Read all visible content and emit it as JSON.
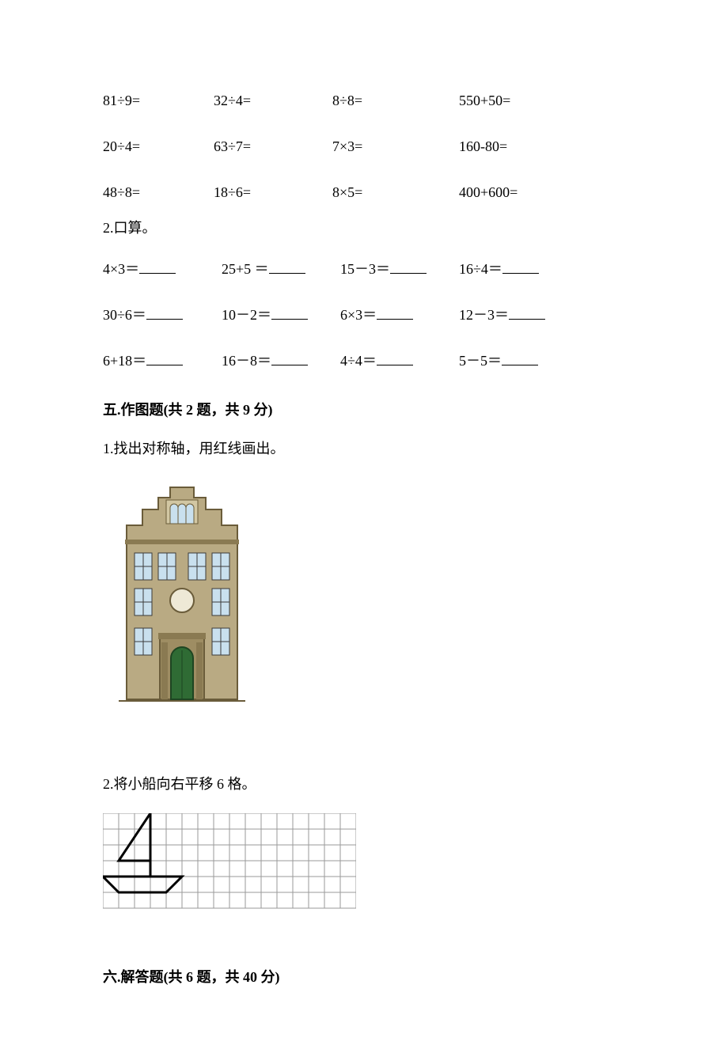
{
  "math_row1": [
    "81÷9=",
    "32÷4=",
    "8÷8=",
    "550+50="
  ],
  "math_row2": [
    "20÷4=",
    "63÷7=",
    "7×3=",
    "160-80="
  ],
  "math_row3": [
    "48÷8=",
    "18÷6=",
    "8×5=",
    "400+600="
  ],
  "sub_label": "2.口算。",
  "fill_row1": [
    "4×3＝",
    "25+5 ＝",
    "15－3＝",
    "16÷4＝"
  ],
  "fill_row2": [
    "30÷6＝",
    "10－2＝",
    "6×3＝",
    "12－3＝"
  ],
  "fill_row3": [
    "6+18＝",
    "16－8＝",
    "4÷4＝",
    "5－5＝"
  ],
  "section5": {
    "title": "五.作图题(共 2 题，共 9 分)",
    "q1": "1.找出对称轴，用红线画出。",
    "q2": "2.将小船向右平移 6 格。"
  },
  "section6": {
    "title": "六.解答题(共 6 题，共 40 分)"
  }
}
